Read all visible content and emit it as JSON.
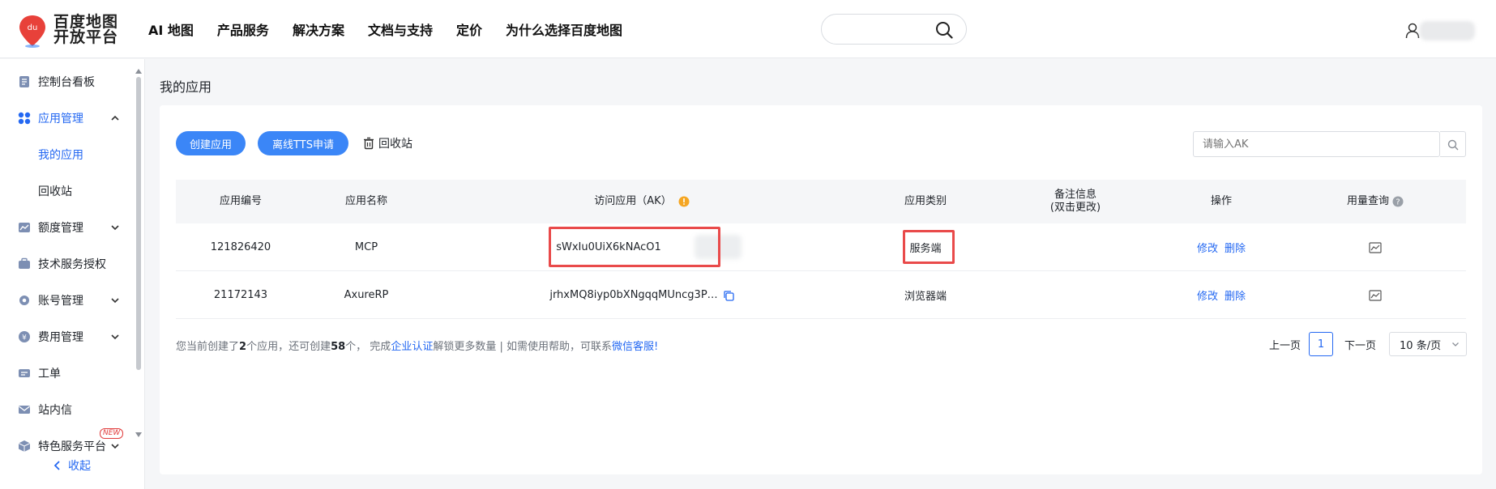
{
  "header": {
    "logo_line1": "百度地图",
    "logo_line2": "开放平台",
    "logo_badge": "du",
    "nav": [
      "AI 地图",
      "产品服务",
      "解决方案",
      "文档与支持",
      "定价",
      "为什么选择百度地图"
    ],
    "search_icon": "search-icon",
    "user_icon": "user-icon"
  },
  "sidebar": {
    "items": [
      {
        "label": "控制台看板",
        "icon": "dashboard-icon"
      },
      {
        "label": "应用管理",
        "icon": "apps-icon",
        "expanded": true
      },
      {
        "label": "我的应用",
        "active": true
      },
      {
        "label": "回收站"
      },
      {
        "label": "额度管理",
        "icon": "chart-line-icon"
      },
      {
        "label": "技术服务授权",
        "icon": "briefcase-icon"
      },
      {
        "label": "账号管理",
        "icon": "gear-icon"
      },
      {
        "label": "费用管理",
        "icon": "yen-icon"
      },
      {
        "label": "工单",
        "icon": "ticket-icon"
      },
      {
        "label": "站内信",
        "icon": "mail-icon"
      },
      {
        "label": "特色服务平台",
        "icon": "cube-icon",
        "badge": "NEW"
      }
    ],
    "collapse_label": "收起"
  },
  "main": {
    "page_title": "我的应用",
    "create_button": "创建应用",
    "tts_button": "离线TTS申请",
    "recycle_label": "回收站",
    "ak_placeholder": "请输入AK",
    "table": {
      "headers": {
        "id": "应用编号",
        "name": "应用名称",
        "ak": "访问应用（AK）",
        "type": "应用类别",
        "remark_line1": "备注信息",
        "remark_line2": "(双击更改)",
        "action": "操作",
        "usage": "用量查询"
      },
      "rows": [
        {
          "id": "121826420",
          "name": "MCP",
          "ak": "sWxIu0UiX6kNAcO1",
          "type": "服务端",
          "edit": "修改",
          "delete": "删除"
        },
        {
          "id": "21172143",
          "name": "AxureRP",
          "ak": "jrhxMQ8iyp0bXNgqqMUncg3P…",
          "type": "浏览器端",
          "edit": "修改",
          "delete": "删除"
        }
      ]
    },
    "footer": {
      "t1": "您当前创建了",
      "created": "2",
      "t2": "个应用，还可创建",
      "remaining": "58",
      "t3": "个，  完成",
      "link_cert": "企业认证",
      "t4": "解锁更多数量  |  如需使用帮助，可联系",
      "link_support": "微信客服!"
    },
    "pager": {
      "prev": "上一页",
      "current": "1",
      "next": "下一页",
      "page_size": "10 条/页"
    }
  },
  "colors": {
    "primary": "#2468f2",
    "button": "#3b86f7",
    "highlight_box": "#e94a4a",
    "logo_red": "#e8413a"
  }
}
